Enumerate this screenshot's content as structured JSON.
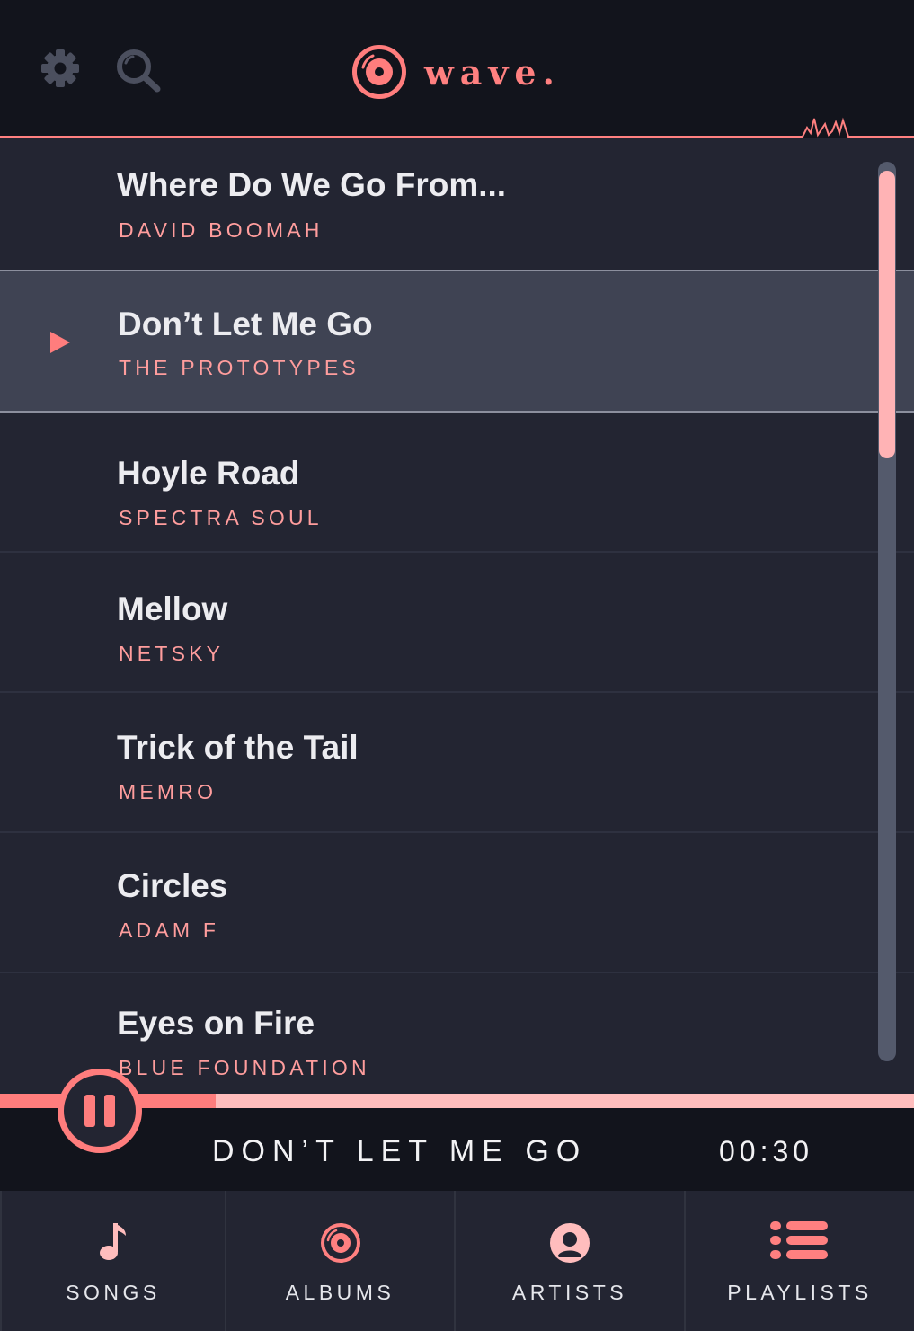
{
  "app": {
    "brand": "wave.",
    "accent_color": "#ff7d7d",
    "background_color": "#232532",
    "header_color": "#12141c"
  },
  "header": {
    "settings_icon": "gear-icon",
    "search_icon": "search-icon",
    "logo_icon": "vinyl-disc-icon"
  },
  "songs": [
    {
      "title": "Where Do We Go From...",
      "artist": "DAVID BOOMAH",
      "playing": false
    },
    {
      "title": "Don’t Let Me Go",
      "artist": "THE PROTOTYPES",
      "playing": true
    },
    {
      "title": "Hoyle Road",
      "artist": "SPECTRA SOUL",
      "playing": false
    },
    {
      "title": "Mellow",
      "artist": "NETSKY",
      "playing": false
    },
    {
      "title": "Trick of the Tail",
      "artist": "MEMRO",
      "playing": false
    },
    {
      "title": "Circles",
      "artist": "ADAM F",
      "playing": false
    },
    {
      "title": "Eyes on Fire",
      "artist": "BLUE FOUNDATION",
      "playing": false
    }
  ],
  "player": {
    "title": "DON’T LET ME GO",
    "time": "00:30",
    "progress": 0.236,
    "state_icon": "pause-icon"
  },
  "tabs": [
    {
      "label": "SONGS",
      "icon": "music-note-icon"
    },
    {
      "label": "ALBUMS",
      "icon": "album-disc-icon"
    },
    {
      "label": "ARTISTS",
      "icon": "person-icon"
    },
    {
      "label": "PLAYLISTS",
      "icon": "list-icon"
    }
  ]
}
